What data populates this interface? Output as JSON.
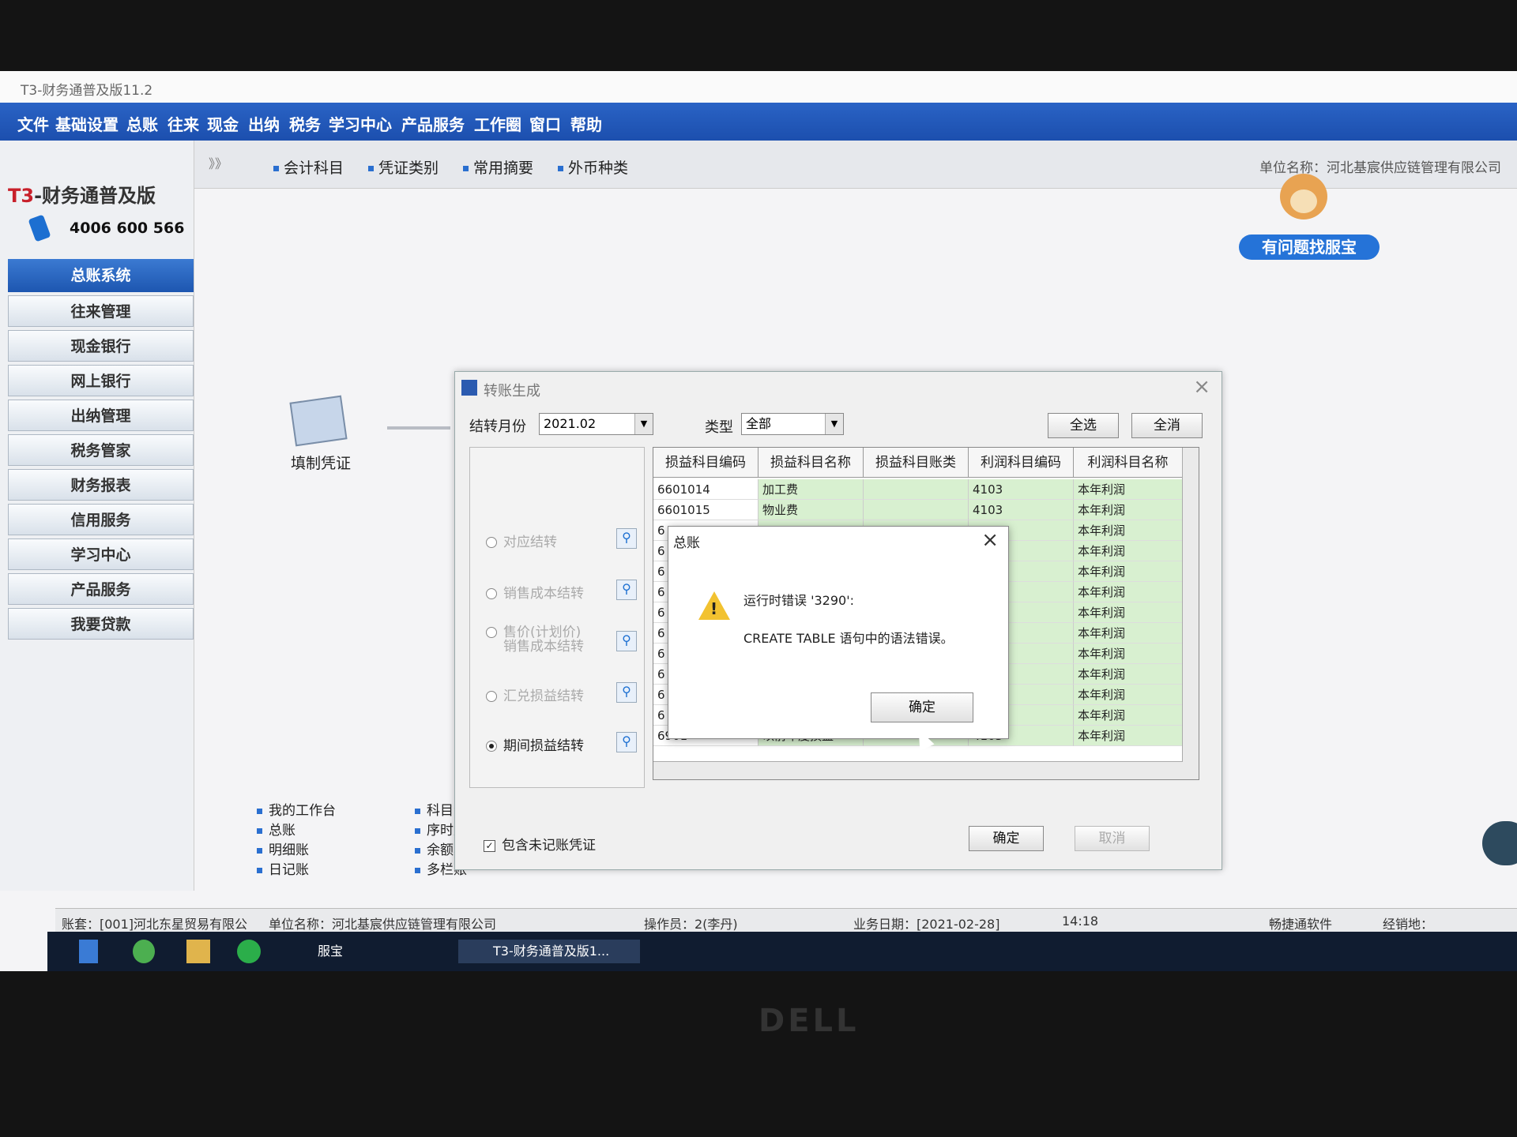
{
  "window": {
    "title": "T3-财务通普及版11.2"
  },
  "menu": [
    "文件",
    "基础设置",
    "总账",
    "往来",
    "现金",
    "出纳",
    "税务",
    "学习中心",
    "产品服务",
    "工作圈",
    "窗口",
    "帮助"
  ],
  "brand": {
    "prefix": "T3",
    "name": "-财务通普及版",
    "hotline": "4006 600 566"
  },
  "sidebar": {
    "header": "总账系统",
    "items": [
      "往来管理",
      "现金银行",
      "网上银行",
      "出纳管理",
      "税务管家",
      "财务报表",
      "信用服务",
      "学习中心",
      "产品服务",
      "我要贷款"
    ]
  },
  "topbar": {
    "expand": "》》",
    "items": [
      "会计科目",
      "凭证类别",
      "常用摘要",
      "外币种类"
    ],
    "unit": "单位名称：河北基宸供应链管理有限公司",
    "help_button": "有问题找服宝"
  },
  "flow": {
    "fill_voucher": "填制凭证"
  },
  "quick_links": {
    "left": [
      "我的工作台",
      "总账",
      "明细账",
      "日记账"
    ],
    "right": [
      "科目汇总",
      "序时账",
      "余额表",
      "多栏账"
    ]
  },
  "dialog": {
    "title": "转账生成",
    "month_label": "结转月份",
    "month_value": "2021.02",
    "type_label": "类型",
    "type_value": "全部",
    "select_all": "全选",
    "deselect_all": "全消",
    "options": [
      {
        "label": "对应结转",
        "selected": false
      },
      {
        "label": "销售成本结转",
        "selected": false
      },
      {
        "label": "售价(计划价)\n销售成本结转",
        "selected": false
      },
      {
        "label": "汇兑损益结转",
        "selected": false
      },
      {
        "label": "期间损益结转",
        "selected": true
      }
    ],
    "columns": [
      "损益科目编码",
      "损益科目名称",
      "损益科目账类",
      "利润科目编码",
      "利润科目名称"
    ],
    "rows": [
      [
        "6601014",
        "加工费",
        "",
        "4103",
        "本年利润"
      ],
      [
        "6601015",
        "物业费",
        "",
        "4103",
        "本年利润"
      ],
      [
        "6",
        "",
        "",
        "",
        "本年利润"
      ],
      [
        "6",
        "",
        "",
        "",
        "本年利润"
      ],
      [
        "6",
        "",
        "",
        "",
        "本年利润"
      ],
      [
        "6",
        "",
        "",
        "",
        "本年利润"
      ],
      [
        "6",
        "",
        "",
        "",
        "本年利润"
      ],
      [
        "6",
        "",
        "",
        "",
        "本年利润"
      ],
      [
        "6",
        "",
        "",
        "",
        "本年利润"
      ],
      [
        "6",
        "",
        "",
        "",
        "本年利润"
      ],
      [
        "6",
        "",
        "",
        "",
        "本年利润"
      ],
      [
        "6",
        "",
        "",
        "",
        "本年利润"
      ],
      [
        "6901",
        "以前年度损益",
        "",
        "4103",
        "本年利润"
      ]
    ],
    "include_unposted": "包含未记账凭证",
    "ok": "确定",
    "cancel": "取消"
  },
  "error_dialog": {
    "title": "总账",
    "line1": "运行时错误 '3290':",
    "line2": "CREATE TABLE 语句中的语法错误。",
    "ok": "确定"
  },
  "status": {
    "account": "账套：[001]河北东星贸易有限公",
    "unit": "单位名称：河北基宸供应链管理有限公司",
    "operator": "操作员：2(李丹)",
    "date": "业务日期：[2021-02-28]",
    "time": "14:18",
    "vendor": "畅捷通软件",
    "dealer": "经销地："
  },
  "taskbar": {
    "app1": "服宝",
    "app2": "T3-财务通普及版1..."
  },
  "monitor_brand": "DELL"
}
